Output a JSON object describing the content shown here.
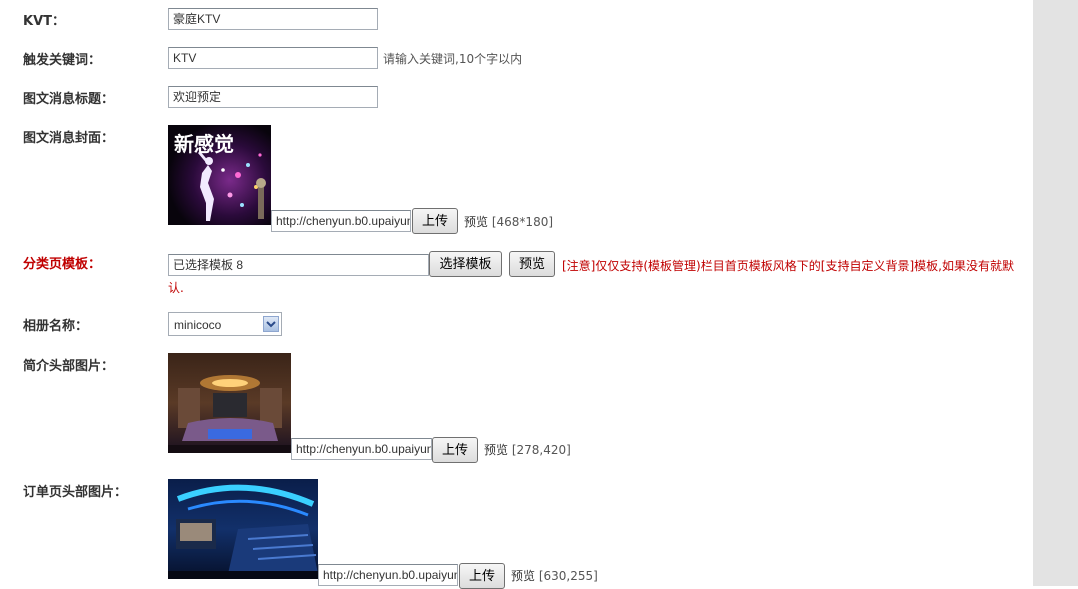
{
  "fields": {
    "kvt": {
      "label": "KVT：",
      "value": "豪庭KTV"
    },
    "keyword": {
      "label": "触发关键词：",
      "value": "KTV",
      "hint": "请输入关键词,10个字以内"
    },
    "title": {
      "label": "图文消息标题：",
      "value": "欢迎预定"
    },
    "cover": {
      "label": "图文消息封面：",
      "url": "http://chenyun.b0.upaiyun",
      "upload": "上传",
      "preview_label": "预览",
      "size": "[468*180]",
      "image_text": "新感觉"
    },
    "template": {
      "label": "分类页模板：",
      "value": "已选择模板 8",
      "choose": "选择模板",
      "preview": "预览",
      "note_a": "[注意]仅仅支持",
      "note_b": "(模板管理)",
      "note_c": "栏目首页模板风格下的",
      "note_d": "[支持自定义背景]",
      "note_e": "模板,如果没有就默认."
    },
    "album": {
      "label": "相册名称：",
      "value": "minicoco"
    },
    "intro_header": {
      "label": "简介头部图片：",
      "url": "http://chenyun.b0.upaiyun",
      "upload": "上传",
      "preview_label": "预览",
      "size": "[278,420]"
    },
    "order_header": {
      "label": "订单页头部图片：",
      "url": "http://chenyun.b0.upaiyun",
      "upload": "上传",
      "preview_label": "预览",
      "size": "[630,255]"
    }
  },
  "colors": {
    "label_red": "#c00000",
    "background": "#ffffff",
    "right_strip": "#e3e3e3"
  }
}
